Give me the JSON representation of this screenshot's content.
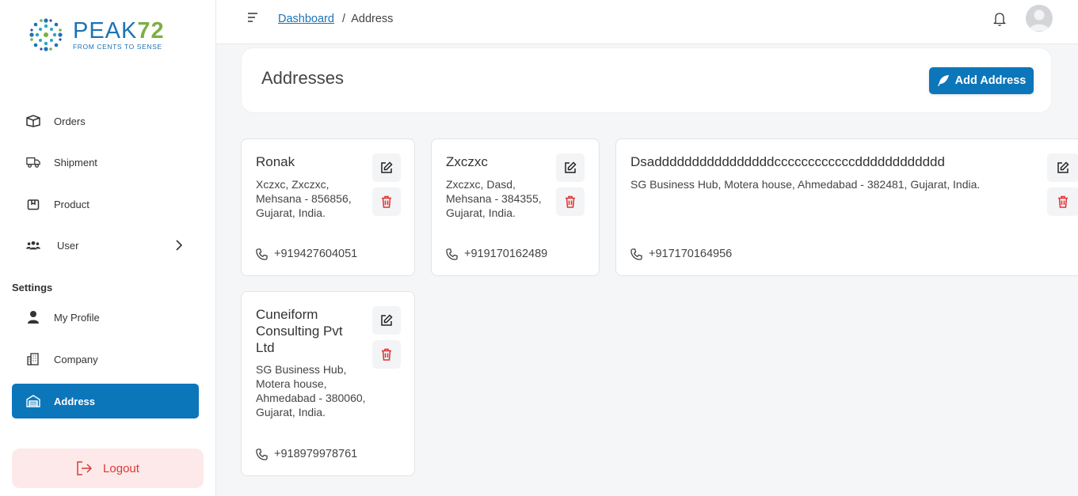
{
  "brand": {
    "name": "PEAK",
    "name_num": "72",
    "tagline": "FROM CENTS TO SENSE"
  },
  "sidebar": {
    "items": [
      {
        "label": "Orders",
        "icon": "box-icon"
      },
      {
        "label": "Shipment",
        "icon": "truck-icon"
      },
      {
        "label": "Product",
        "icon": "package-icon"
      },
      {
        "label": "User",
        "icon": "users-icon"
      }
    ],
    "settings_title": "Settings",
    "settings_items": [
      {
        "label": "My Profile",
        "icon": "person-icon"
      },
      {
        "label": "Company",
        "icon": "building-icon"
      },
      {
        "label": "Address",
        "icon": "warehouse-icon",
        "active": true
      }
    ],
    "logout_label": "Logout"
  },
  "breadcrumb": {
    "parent": "Dashboard",
    "separator": "/",
    "current": "Address"
  },
  "header": {
    "title": "Addresses",
    "add_button": "Add Address"
  },
  "addresses": [
    {
      "name": "Ronak",
      "address": "Xczxc, Zxczxc, Mehsana - 856856, Gujarat, India.",
      "phone": "+919427604051"
    },
    {
      "name": "Zxczxc",
      "address": "Zxczxc, Dasd, Mehsana - 384355, Gujarat, India.",
      "phone": "+919170162489"
    },
    {
      "name": "Dsaddddddddddddddddccccccccccccdddddddddddd",
      "address": "SG Business Hub, Motera house, Ahmedabad - 382481, Gujarat, India.",
      "phone": "+917170164956"
    },
    {
      "name": "Cuneiform Consulting Pvt Ltd",
      "address": "SG Business Hub, Motera house, Ahmedabad - 380060, Gujarat, India.",
      "phone": "+918979978761"
    }
  ],
  "colors": {
    "primary": "#0c76bb",
    "danger": "#e03131",
    "logout_bg": "#fde9e9"
  }
}
